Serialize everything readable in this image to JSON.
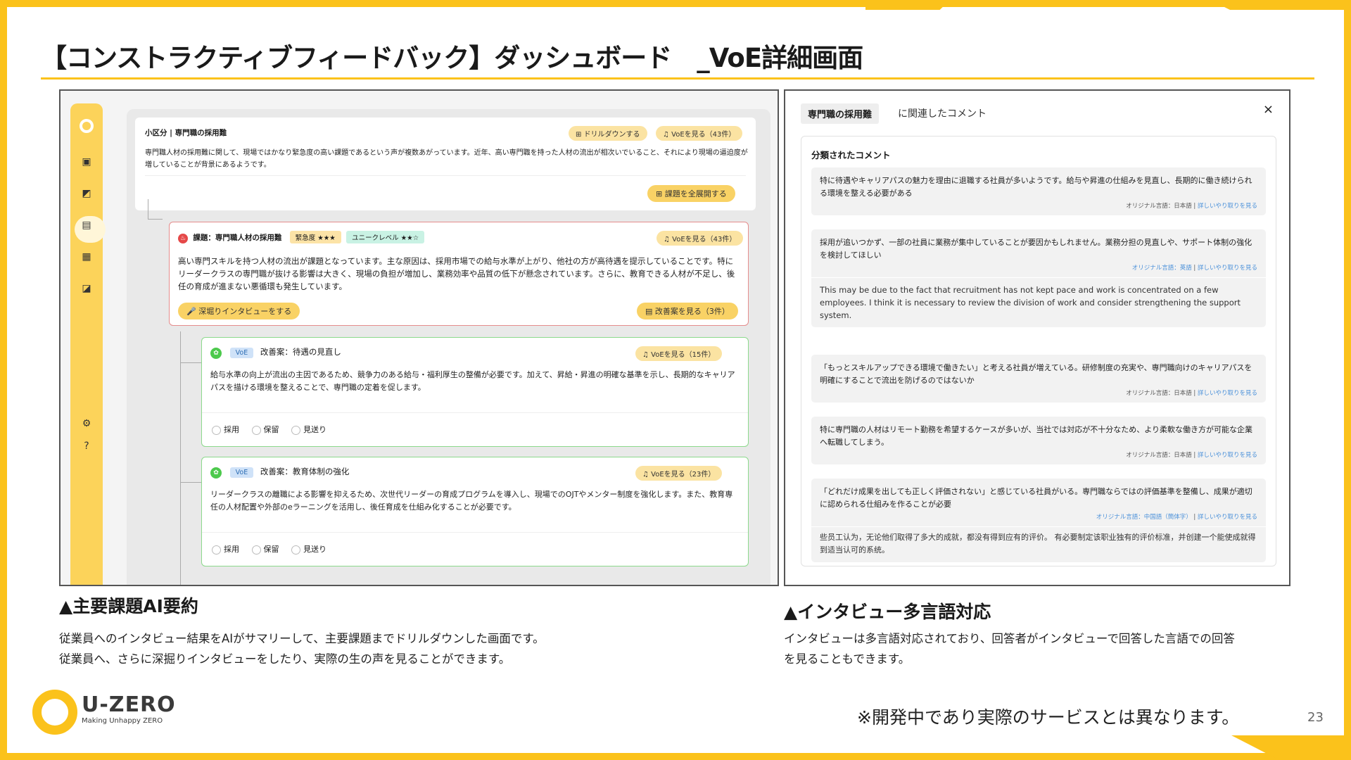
{
  "slide": {
    "title": "【コンストラクティブフィードバック】ダッシュボード　_VoE詳細画面",
    "page_number": "23",
    "disclaimer": "※開発中であり実際のサービスとは異なります。",
    "accent_color": "#FBC21B"
  },
  "left_screen": {
    "summary_card": {
      "heading": "小区分 | 専門職の採用難",
      "drilldown_label": "ドリルダウンする",
      "voe_label": "VoEを見る（43件）",
      "body": "専門職人材の採用難に関して、現場ではかなり緊急度の高い課題であるという声が複数あがっています。近年、高い専門職を持った人材の流出が相次いでいること、それにより現場の逼迫度が増していることが背景にあるようです。",
      "expand_label": "課題を全展開する"
    },
    "issue_card": {
      "title": "課題：専門職人材の採用難",
      "urgency_tag": "緊急度 ★★★",
      "unique_tag": "ユニークレベル ★★☆",
      "voe_label": "VoEを見る（43件）",
      "body": "高い専門スキルを持つ人材の流出が課題となっています。主な原因は、採用市場での給与水準が上がり、他社の方が高待遇を提示していることです。特にリーダークラスの専門職が抜ける影響は大きく、現場の負担が増加し、業務効率や品質の低下が懸念されています。さらに、教育できる人材が不足し、後任の育成が進まない悪循環も発生しています。",
      "interview_label": "深堀りインタビューをする",
      "improve_label": "改善案を見る（3件）"
    },
    "proposals": [
      {
        "tag": "VoE",
        "title": "改善案：待遇の見直し",
        "voe_label": "VoEを見る（15件）",
        "body": "給与水準の向上が流出の主因であるため、競争力のある給与・福利厚生の整備が必要です。加えて、昇給・昇進の明確な基準を示し、長期的なキャリアパスを描ける環境を整えることで、専門職の定着を促します。",
        "options": [
          "採用",
          "保留",
          "見送り"
        ]
      },
      {
        "tag": "VoE",
        "title": "改善案：教育体制の強化",
        "voe_label": "VoEを見る（23件）",
        "body": "リーダークラスの離職による影響を抑えるため、次世代リーダーの育成プログラムを導入し、現場でのOJTやメンター制度を強化します。また、教育専任の人材配置や外部のeラーニングを活用し、後任育成を仕組み化することが必要です。",
        "options": [
          "採用",
          "保留",
          "見送り"
        ]
      }
    ],
    "sidebar_icons": [
      "dashboard-icon",
      "chart-icon",
      "voe-icon",
      "report-icon",
      "feedback-icon",
      "settings-icon",
      "help-icon"
    ]
  },
  "right_screen": {
    "header_tag": "専門職の採用難",
    "header_rest": "に関連したコメント",
    "close": "×",
    "box_title": "分類されたコメント",
    "comments": [
      {
        "text": "特に待遇やキャリアパスの魅力を理由に退職する社員が多いようです。給与や昇進の仕組みを見直し、長期的に働き続けられる環境を整える必要がある",
        "meta": "オリジナル言語：日本語",
        "link": "詳しいやり取りを見る",
        "original": ""
      },
      {
        "text": "採用が追いつかず、一部の社員に業務が集中していることが要因かもしれません。業務分担の見直しや、サポート体制の強化を検討してほしい",
        "meta": "オリジナル言語：英語",
        "link": "詳しいやり取りを見る",
        "original": "This may be due to the fact that recruitment has not kept pace and work is concentrated on a few employees. I think it is necessary to review the division of work and consider strengthening the support system."
      },
      {
        "text": "「もっとスキルアップできる環境で働きたい」と考える社員が増えている。研修制度の充実や、専門職向けのキャリアパスを明確にすることで流出を防げるのではないか",
        "meta": "オリジナル言語：日本語",
        "link": "詳しいやり取りを見る",
        "original": ""
      },
      {
        "text": "特に専門職の人材はリモート勤務を希望するケースが多いが、当社では対応が不十分なため、より柔軟な働き方が可能な企業へ転職してしまう。",
        "meta": "オリジナル言語：日本語",
        "link": "詳しいやり取りを見る",
        "original": ""
      },
      {
        "text": "「どれだけ成果を出しても正しく評価されない」と感じている社員がいる。専門職ならではの評価基準を整備し、成果が適切に認められる仕組みを作ることが必要",
        "meta": "オリジナル言語：中国語（簡体字）",
        "link": "詳しいやり取りを見る",
        "original": "些员工认为，无论他们取得了多大的成就，都没有得到应有的评价。 有必要制定该职业独有的评价标准，并创建一个能使成就得到适当认可的系统。"
      }
    ]
  },
  "sections": {
    "left": {
      "heading": "▲主要課題AI要約",
      "line1": "従業員へのインタビュー結果をAIがサマリーして、主要課題までドリルダウンした画面です。",
      "line2": "従業員へ、さらに深掘りインタビューをしたり、実際の生の声を見ることができます。"
    },
    "right": {
      "heading": "▲インタビュー多言語対応",
      "line1": "インタビューは多言語対応されており、回答者がインタビューで回答した言語での回答",
      "line2": "を見ることもできます。"
    }
  },
  "logo": {
    "name": "U-ZERO",
    "tagline": "Making Unhappy ZERO"
  }
}
